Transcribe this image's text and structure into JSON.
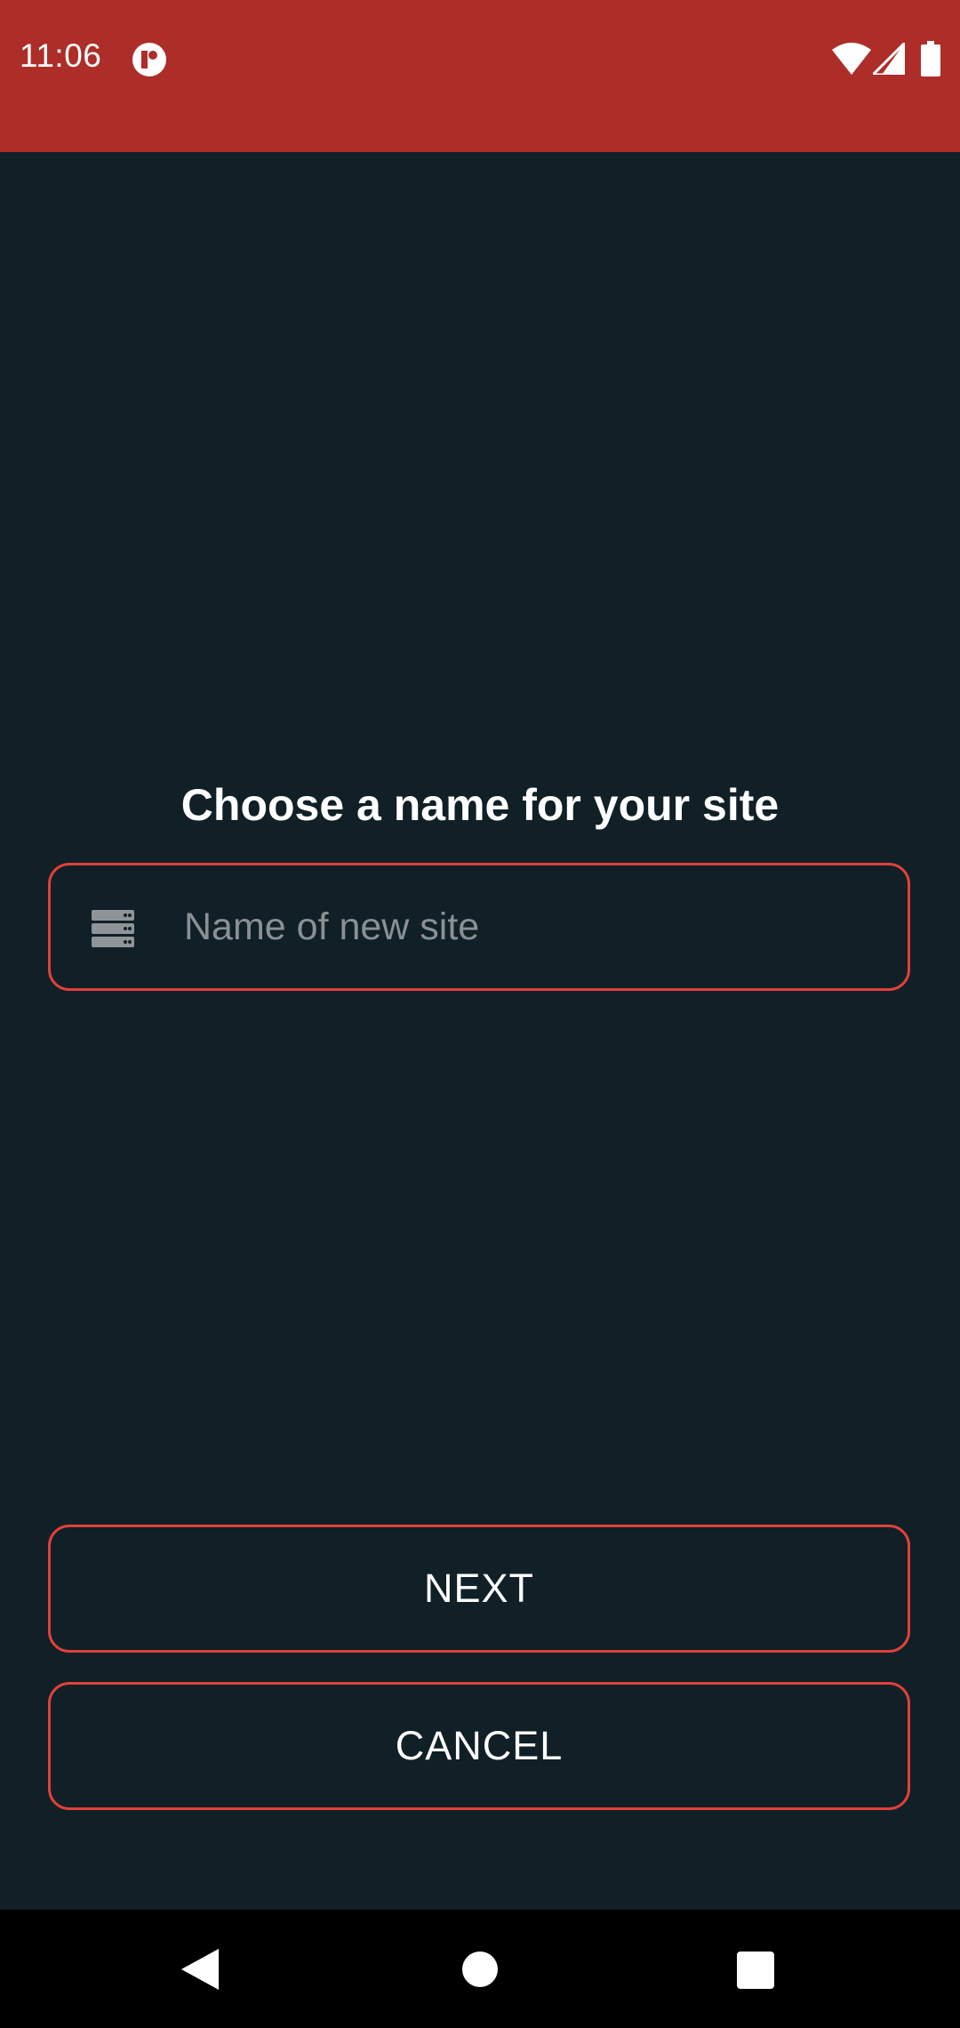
{
  "status_bar": {
    "time": "11:06",
    "background_color": "#ad2d28",
    "icons": [
      "app-notification-icon",
      "wifi-icon",
      "cell-signal-icon",
      "battery-icon"
    ]
  },
  "main": {
    "title": "Choose a name for your site",
    "site_name": {
      "value": "",
      "placeholder": "Name of new site",
      "icon": "server-icon"
    },
    "next_label": "NEXT",
    "cancel_label": "CANCEL",
    "accent_color": "#e0413a",
    "background_color": "#111f26"
  },
  "nav_bar": {
    "buttons": [
      "back-icon",
      "home-icon",
      "recents-icon"
    ]
  }
}
